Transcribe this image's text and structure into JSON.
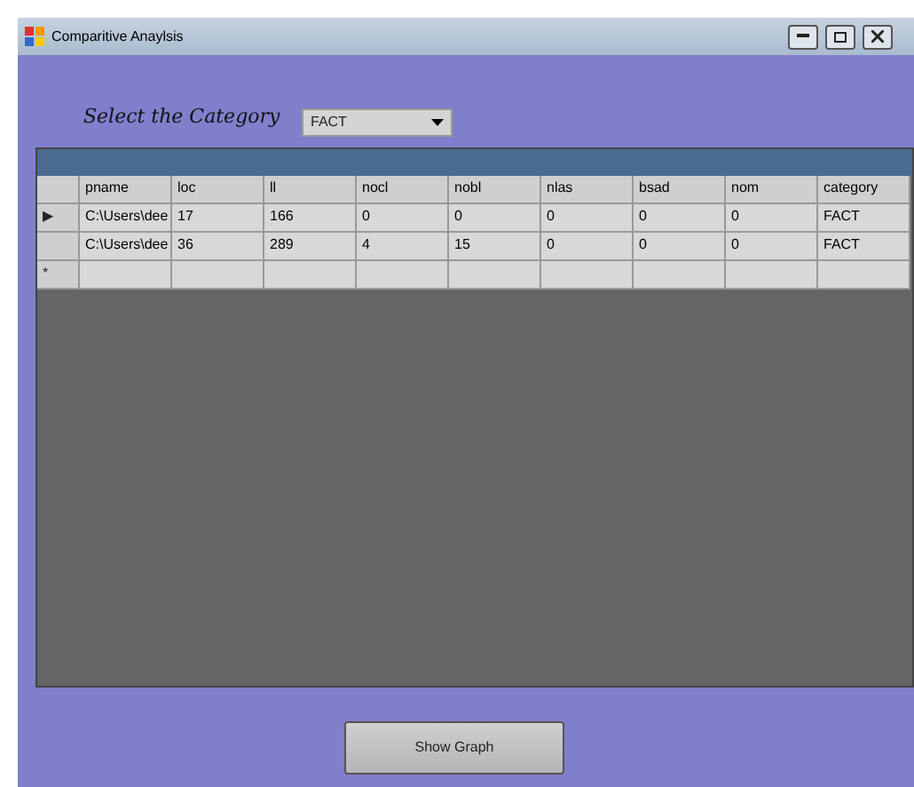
{
  "window": {
    "title": "Comparitive Anaylsis"
  },
  "category": {
    "label": "Select the Category",
    "value": "FACT"
  },
  "grid": {
    "columns": [
      "pname",
      "loc",
      "ll",
      "nocl",
      "nobl",
      "nlas",
      "bsad",
      "nom",
      "category"
    ],
    "rows": [
      {
        "marker": "▶",
        "cells": [
          "C:\\Users\\dee",
          "17",
          "166",
          "0",
          "0",
          "0",
          "0",
          "0",
          "FACT"
        ]
      },
      {
        "marker": "",
        "cells": [
          "C:\\Users\\dee",
          "36",
          "289",
          "4",
          "15",
          "0",
          "0",
          "0",
          "FACT"
        ]
      },
      {
        "marker": "*",
        "cells": []
      }
    ]
  },
  "buttons": [
    "Show Graph"
  ]
}
